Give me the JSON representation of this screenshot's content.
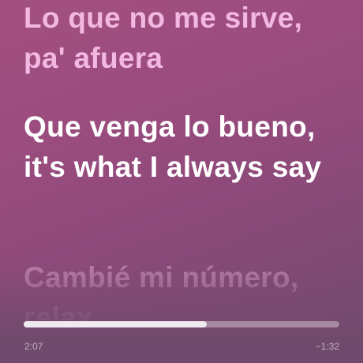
{
  "lyrics": {
    "previous": "Lo que no me sirve, pa' afuera",
    "current": "Que venga lo bueno, it's what I always say",
    "next": "Cambié mi número, relax"
  },
  "playback": {
    "elapsed": "2:07",
    "remaining": "−1:32",
    "progress_fraction": 0.58
  },
  "colors": {
    "background_top": "#a2507f",
    "background_bottom": "#6e4a6c",
    "previous_line": "#f2b8e2",
    "current_line": "#ffffff"
  }
}
